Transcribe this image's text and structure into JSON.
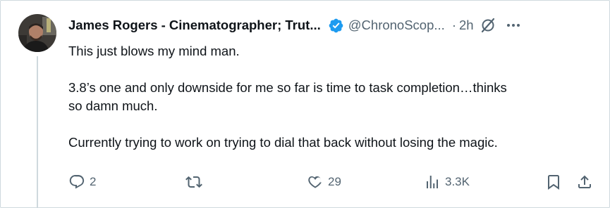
{
  "tweet": {
    "display_name": "James Rogers - Cinematographer; Trut...",
    "handle": "@ChronoScop...",
    "separator": "·",
    "time": "2h",
    "body": {
      "line1": "This just blows my mind man.",
      "line2a": "3.8’s one and only downside for me so far is time to task completion…thinks",
      "line2b": "so damn much.",
      "line3": "Currently trying to work on trying to dial that back without losing the magic."
    },
    "actions": {
      "replies": "2",
      "reposts": "",
      "likes": "29",
      "views": "3.3K"
    }
  },
  "colors": {
    "verified": "#1d9bf0",
    "muted": "#536471",
    "text": "#0f1419",
    "border": "#cfd9de"
  },
  "icons": [
    "reply-icon",
    "repost-icon",
    "like-icon",
    "views-icon",
    "bookmark-icon",
    "share-icon",
    "verified-badge-icon",
    "grok-slash-icon",
    "more-icon"
  ]
}
